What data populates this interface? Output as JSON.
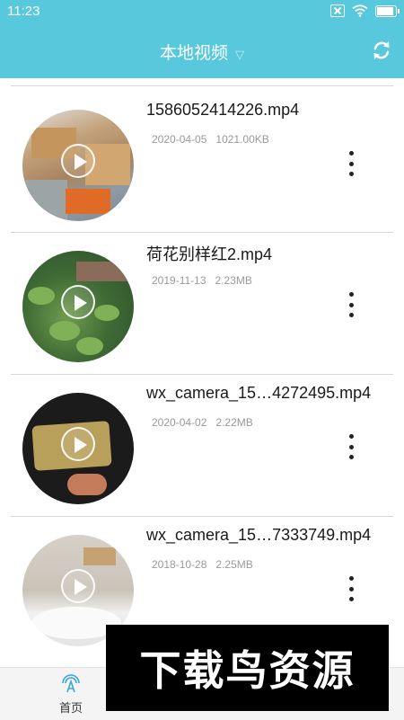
{
  "status_bar": {
    "time": "11:23"
  },
  "header": {
    "title": "本地视频"
  },
  "videos": [
    {
      "name": "1586052414226.mp4",
      "date": "2020-04-05",
      "size": "1021.00KB"
    },
    {
      "name": "荷花别样红2.mp4",
      "date": "2019-11-13",
      "size": "2.23MB"
    },
    {
      "name": "wx_camera_15…4272495.mp4",
      "date": "2020-04-02",
      "size": "2.22MB"
    },
    {
      "name": "wx_camera_15…7333749.mp4",
      "date": "2018-10-28",
      "size": "2.25MB"
    }
  ],
  "tabbar": {
    "home_label": "首页",
    "active_color": "#3aa6d8"
  },
  "watermark": {
    "text": "下载鸟资源"
  },
  "colors": {
    "header_bg": "#58c8dc",
    "text_secondary": "#9a9a9a"
  }
}
